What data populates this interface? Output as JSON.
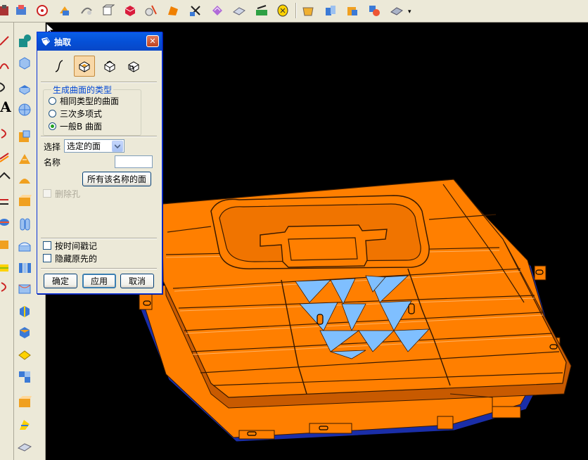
{
  "toolbar": {
    "icons": [
      "tool-icon-1",
      "tool-icon-2",
      "tool-icon-3",
      "tool-icon-4",
      "tool-icon-5",
      "tool-icon-6",
      "tool-icon-7",
      "tool-icon-8",
      "tool-icon-9",
      "tool-icon-10",
      "tool-icon-11",
      "tool-icon-12",
      "tool-icon-13",
      "tool-icon-14",
      "tool-icon-15",
      "tool-icon-16",
      "tool-icon-17",
      "tool-icon-18"
    ],
    "more_glyph": "▾"
  },
  "left_toolbar": {
    "text_tool_label": "A"
  },
  "dialog": {
    "title": "抽取",
    "close_glyph": "✕",
    "mode_buttons": [
      "curve-mode-icon",
      "face-mode-icon",
      "region-mode-icon",
      "body-mode-icon"
    ],
    "group_title": "生成曲面的类型",
    "radios": [
      {
        "label": "相同类型的曲面",
        "checked": false
      },
      {
        "label": "三次多项式",
        "checked": false
      },
      {
        "label": "一般B 曲面",
        "checked": true
      }
    ],
    "select_label": "选择",
    "select_value": "选定的面",
    "name_label": "名称",
    "name_value": "",
    "all_name_button": "所有该名称的面",
    "delete_holes_label": "删除孔",
    "timestamp_label": "按时间戳记",
    "hide_original_label": "隐藏原先的",
    "ok_label": "确定",
    "apply_label": "应用",
    "cancel_label": "取消"
  },
  "colors": {
    "model_orange": "#ff7f00",
    "model_edge": "#3a1a00",
    "model_blue": "#1a2ea8",
    "selected_face": "#7fbfff",
    "titlebar_blue": "#0550d7"
  }
}
